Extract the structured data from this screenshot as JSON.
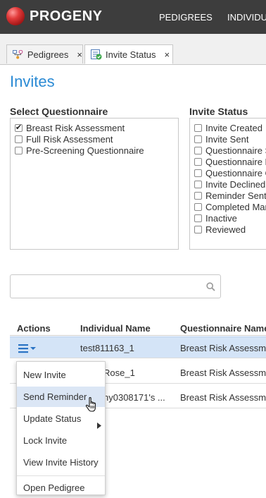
{
  "header": {
    "logo_text": "PROGENY",
    "nav": [
      "PEDIGREES",
      "INDIVIDUA"
    ],
    "accent": "#2a8ad4"
  },
  "tabs": [
    {
      "label": "Pedigrees",
      "icon": "pedigree-icon",
      "close": "×"
    },
    {
      "label": "Invite Status",
      "icon": "invite-status-icon",
      "close": "×"
    }
  ],
  "page": {
    "title": "Invites"
  },
  "questionnaire": {
    "label": "Select Questionnaire",
    "options": [
      {
        "label": "Breast Risk Assessment",
        "checked": true
      },
      {
        "label": "Full Risk Assessment",
        "checked": false
      },
      {
        "label": "Pre-Screening Questionnaire",
        "checked": false
      }
    ]
  },
  "invite_status": {
    "label": "Invite Status",
    "options": [
      {
        "label": "Invite Created",
        "checked": false
      },
      {
        "label": "Invite Sent",
        "checked": false
      },
      {
        "label": "Questionnaire S",
        "checked": false
      },
      {
        "label": "Questionnaire R",
        "checked": false
      },
      {
        "label": "Questionnaire C",
        "checked": false
      },
      {
        "label": "Invite Declined",
        "checked": false
      },
      {
        "label": "Reminder Sent",
        "checked": false
      },
      {
        "label": "Completed Mar",
        "checked": false
      },
      {
        "label": "Inactive",
        "checked": false
      },
      {
        "label": "Reviewed",
        "checked": false
      }
    ]
  },
  "search": {
    "value": "",
    "placeholder": "",
    "icon": "search-icon"
  },
  "table": {
    "headers": [
      "Actions",
      "Individual Name",
      "Questionnaire Name"
    ],
    "rows": [
      {
        "individual": "test811163_1",
        "questionnaire": "Breast Risk Assessm",
        "selected": true
      },
      {
        "individual": "Rose_1",
        "questionnaire": "Breast Risk Assessm",
        "selected": false
      },
      {
        "individual": "ny0308171's ...",
        "questionnaire": "Breast Risk Assessm",
        "selected": false
      }
    ]
  },
  "actions_menu": {
    "items": [
      {
        "label": "New Invite",
        "submenu": false,
        "highlighted": false
      },
      {
        "label": "Send Reminder",
        "submenu": false,
        "highlighted": true
      },
      {
        "label": "Update Status",
        "submenu": true,
        "highlighted": false
      },
      {
        "label": "Lock Invite",
        "submenu": false,
        "highlighted": false
      },
      {
        "label": "View Invite History",
        "submenu": false,
        "highlighted": false
      },
      {
        "label": "Open Pedigree",
        "submenu": false,
        "highlighted": false
      }
    ]
  }
}
